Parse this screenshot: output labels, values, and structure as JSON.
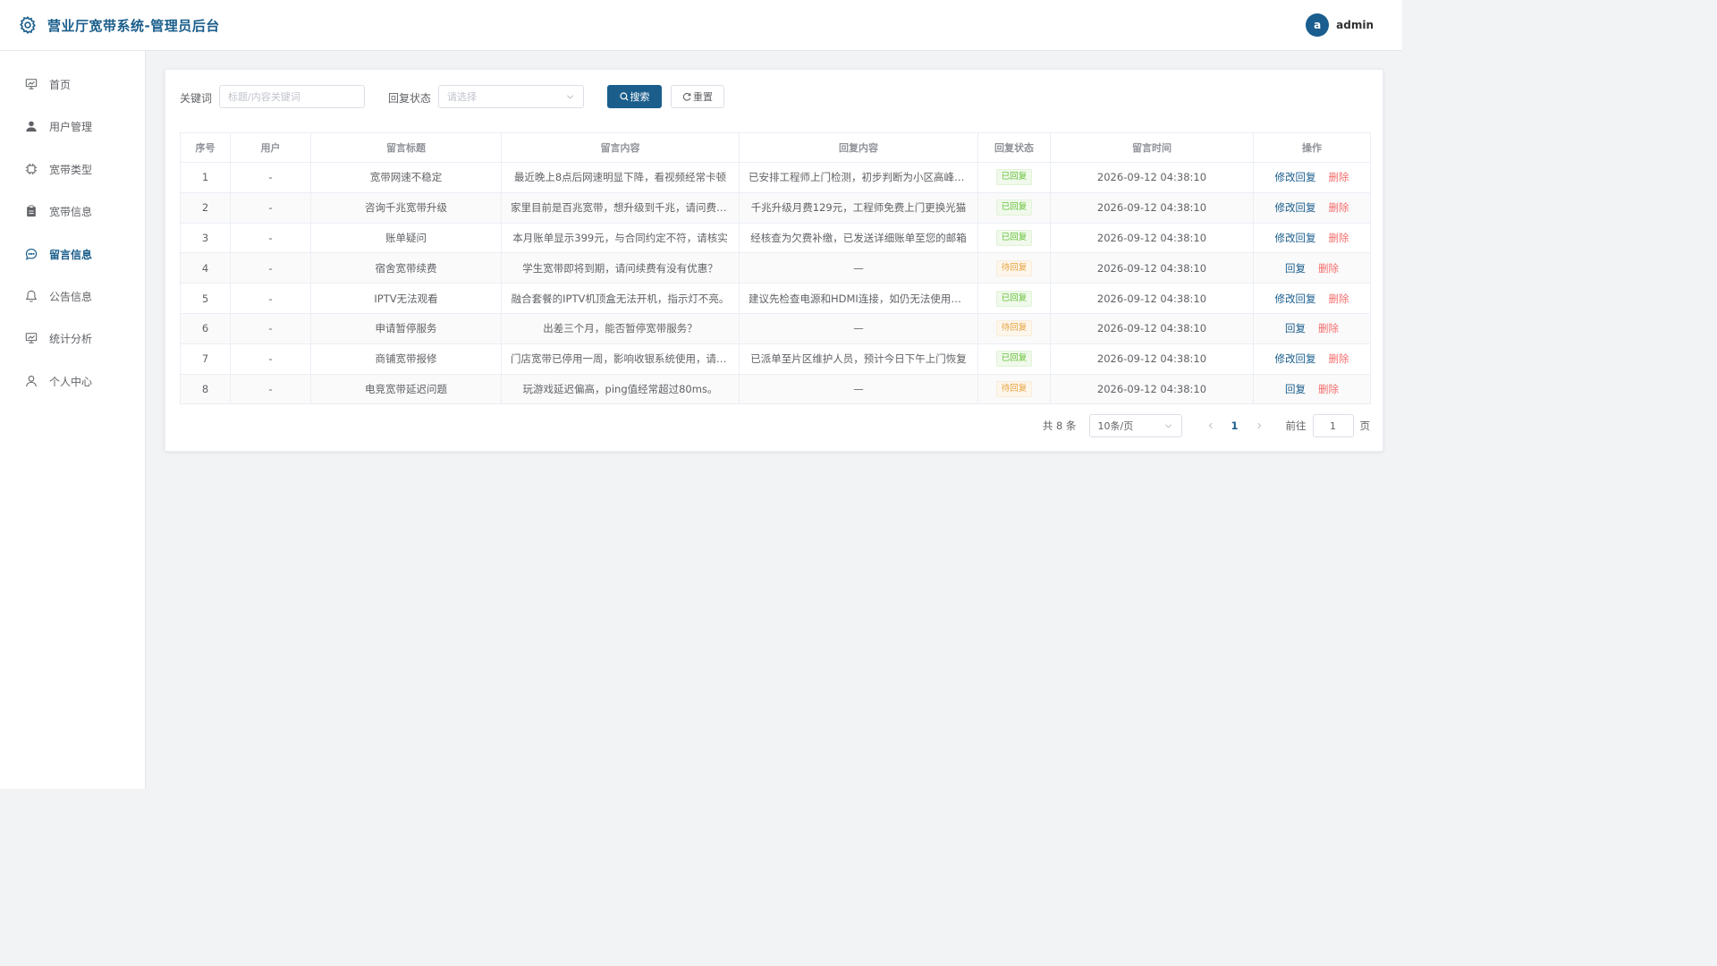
{
  "header": {
    "title": "营业厅宽带系统-管理员后台",
    "avatar_letter": "a",
    "username": "admin"
  },
  "sidebar": {
    "items": [
      {
        "label": "首页",
        "icon": "monitor-icon"
      },
      {
        "label": "用户管理",
        "icon": "user-icon"
      },
      {
        "label": "宽带类型",
        "icon": "chip-icon"
      },
      {
        "label": "宽带信息",
        "icon": "clipboard-icon"
      },
      {
        "label": "留言信息",
        "icon": "chat-icon"
      },
      {
        "label": "公告信息",
        "icon": "bell-icon"
      },
      {
        "label": "统计分析",
        "icon": "chart-icon"
      },
      {
        "label": "个人中心",
        "icon": "person-icon"
      }
    ],
    "active_index": 4
  },
  "filters": {
    "keyword_label": "关键词",
    "keyword_placeholder": "标题/内容关键词",
    "status_label": "回复状态",
    "status_placeholder": "请选择",
    "search_label": "搜索",
    "reset_label": "重置"
  },
  "table": {
    "headers": [
      "序号",
      "用户",
      "留言标题",
      "留言内容",
      "回复内容",
      "回复状态",
      "留言时间",
      "操作"
    ],
    "rows": [
      {
        "no": "1",
        "user": "-",
        "title": "宽带网速不稳定",
        "content": "最近晚上8点后网速明显下降，看视频经常卡顿",
        "reply": "已安排工程师上门检测，初步判断为小区高峰期拥堵",
        "status": "已回复",
        "time": "2026-09-12 04:38:10",
        "actions": [
          "修改回复",
          "删除"
        ]
      },
      {
        "no": "2",
        "user": "-",
        "title": "咨询千兆宽带升级",
        "content": "家里目前是百兆宽带，想升级到千兆，请问费用多少",
        "reply": "千兆升级月费129元，工程师免费上门更换光猫",
        "status": "已回复",
        "time": "2026-09-12 04:38:10",
        "actions": [
          "修改回复",
          "删除"
        ]
      },
      {
        "no": "3",
        "user": "-",
        "title": "账单疑问",
        "content": "本月账单显示399元，与合同约定不符，请核实",
        "reply": "经核查为欠费补缴，已发送详细账单至您的邮箱",
        "status": "已回复",
        "time": "2026-09-12 04:38:10",
        "actions": [
          "修改回复",
          "删除"
        ]
      },
      {
        "no": "4",
        "user": "-",
        "title": "宿舍宽带续费",
        "content": "学生宽带即将到期，请问续费有没有优惠？",
        "reply": "—",
        "status": "待回复",
        "time": "2026-09-12 04:38:10",
        "actions": [
          "回复",
          "删除"
        ]
      },
      {
        "no": "5",
        "user": "-",
        "title": "IPTV无法观看",
        "content": "融合套餐的IPTV机顶盒无法开机，指示灯不亮。",
        "reply": "建议先检查电源和HDMI连接，如仍无法使用请报修",
        "status": "已回复",
        "time": "2026-09-12 04:38:10",
        "actions": [
          "修改回复",
          "删除"
        ]
      },
      {
        "no": "6",
        "user": "-",
        "title": "申请暂停服务",
        "content": "出差三个月，能否暂停宽带服务？",
        "reply": "—",
        "status": "待回复",
        "time": "2026-09-12 04:38:10",
        "actions": [
          "回复",
          "删除"
        ]
      },
      {
        "no": "7",
        "user": "-",
        "title": "商铺宽带报修",
        "content": "门店宽带已停用一周，影响收银系统使用，请尽快处理",
        "reply": "已派单至片区维护人员，预计今日下午上门恢复",
        "status": "已回复",
        "time": "2026-09-12 04:38:10",
        "actions": [
          "修改回复",
          "删除"
        ]
      },
      {
        "no": "8",
        "user": "-",
        "title": "电竞宽带延迟问题",
        "content": "玩游戏延迟偏高，ping值经常超过80ms。",
        "reply": "—",
        "status": "待回复",
        "time": "2026-09-12 04:38:10",
        "actions": [
          "回复",
          "删除"
        ]
      }
    ]
  },
  "pagination": {
    "total_text": "共 8 条",
    "page_size": "10条/页",
    "current_page": "1",
    "goto_label": "前往",
    "goto_value": "1",
    "page_suffix": "页"
  },
  "colors": {
    "brand": "#1b5e8c",
    "success": "#67c23a",
    "warning": "#e6a23c",
    "danger": "#f56c6c"
  }
}
